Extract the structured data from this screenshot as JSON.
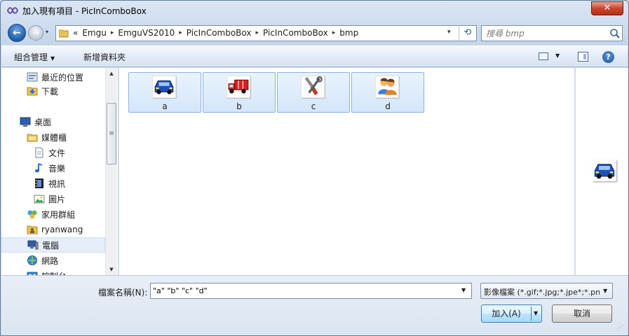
{
  "window": {
    "title": "加入現有項目 - PicInComboBox",
    "close_label": "✕"
  },
  "navigation": {
    "back_icon": "back-arrow-icon",
    "forward_icon": "forward-arrow-icon",
    "history_dropdown": "▾"
  },
  "address": {
    "overflow": "«",
    "crumbs": [
      "Emgu",
      "EmguVS2010",
      "PicInComboBox",
      "PicInComboBox",
      "bmp"
    ],
    "separator": "▸",
    "dropdown": "▾",
    "refresh": "⟲"
  },
  "search": {
    "placeholder": "搜尋 bmp",
    "value": ""
  },
  "commandbar": {
    "organize_label": "組合管理",
    "organize_arrow": "▼",
    "new_folder_label": "新增資料夾",
    "view_arrow": "▼",
    "help_label": "?"
  },
  "navpane": {
    "items": [
      {
        "label": "最近的位置",
        "icon": "recent-places-icon"
      },
      {
        "label": "下載",
        "icon": "downloads-folder-icon"
      },
      {
        "label": "桌面",
        "icon": "desktop-icon"
      },
      {
        "label": "媒體櫃",
        "icon": "libraries-icon"
      },
      {
        "label": "文件",
        "icon": "documents-icon"
      },
      {
        "label": "音樂",
        "icon": "music-icon"
      },
      {
        "label": "視訊",
        "icon": "videos-icon"
      },
      {
        "label": "圖片",
        "icon": "pictures-icon"
      },
      {
        "label": "家用群組",
        "icon": "homegroup-icon"
      },
      {
        "label": "ryanwang",
        "icon": "user-folder-icon"
      },
      {
        "label": "電腦",
        "icon": "computer-icon",
        "selected": true
      },
      {
        "label": "網路",
        "icon": "network-icon"
      },
      {
        "label": "控制台",
        "icon": "control-panel-icon"
      }
    ],
    "scroll_up": "▲",
    "scroll_down": "▼",
    "scroll_grip": "≡"
  },
  "files": [
    {
      "name": "a",
      "icon": "blue-car-icon"
    },
    {
      "name": "b",
      "icon": "red-truck-icon"
    },
    {
      "name": "c",
      "icon": "tools-icon"
    },
    {
      "name": "d",
      "icon": "users-icon"
    }
  ],
  "preview": {
    "icon": "blue-car-icon"
  },
  "footer": {
    "filename_label": "檔案名稱(N):",
    "filename_value": "\"a\" \"b\" \"c\" \"d\"",
    "filename_arrow": "▼",
    "filetype_value": "影像檔案 (*.gif;*.jpg;*.jpe*;*.pn",
    "filetype_arrow": "▼",
    "add_label": "加入(A)",
    "add_arrow": "▼",
    "cancel_label": "取消",
    "grip": "⋰"
  },
  "colors": {
    "accent": "#3c7fb1",
    "selection": "#d4e6fb",
    "close": "#c8452b"
  }
}
